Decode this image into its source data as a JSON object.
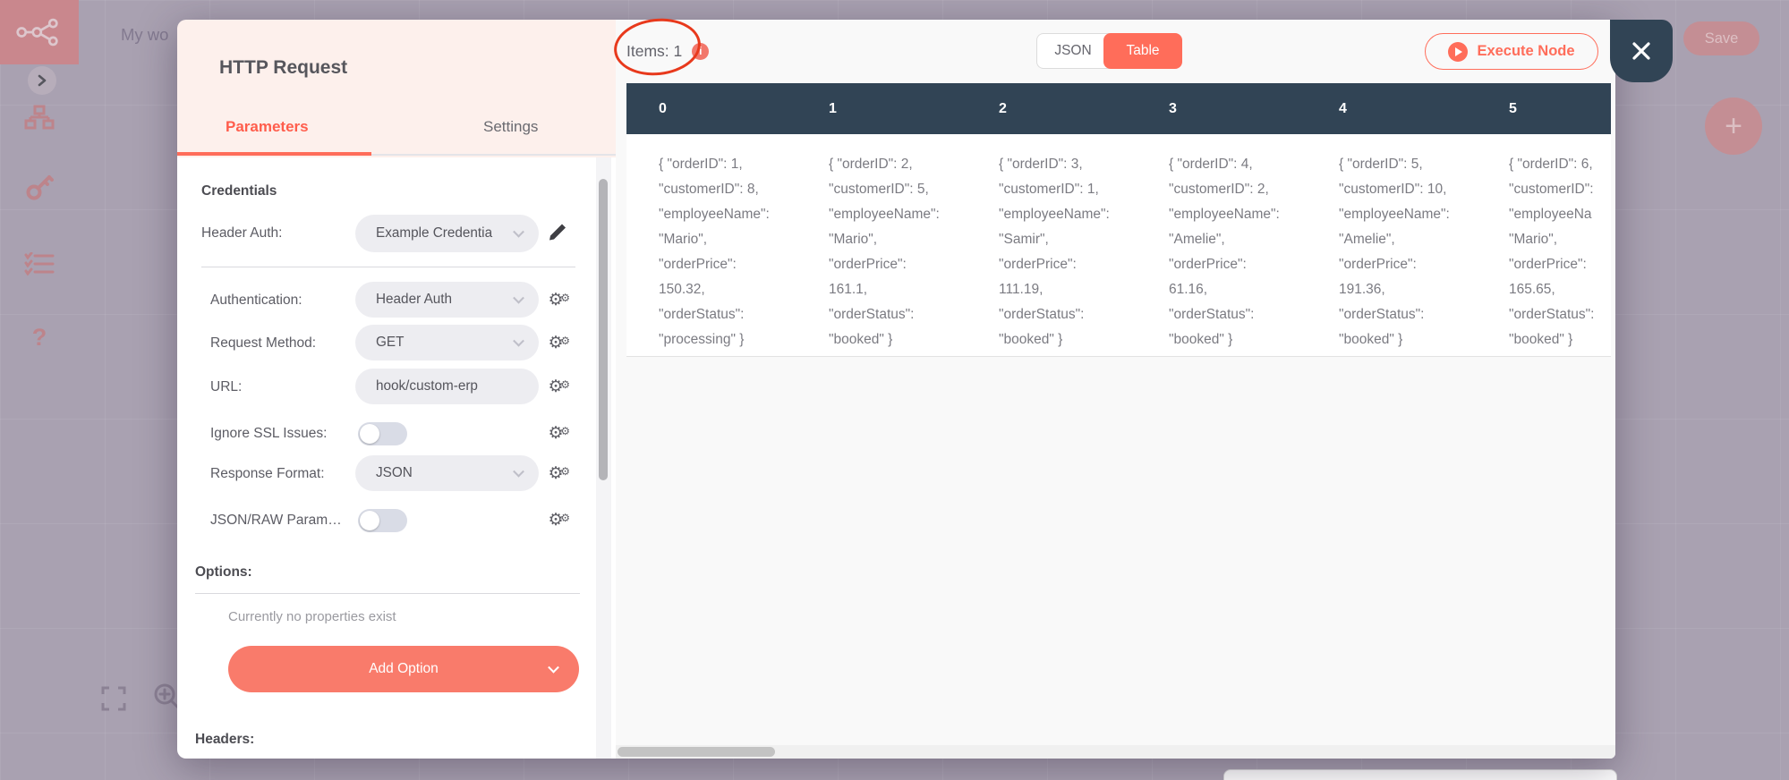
{
  "canvas": {
    "workflow_title": "My wo",
    "save_label": "Save",
    "plus_label": "+",
    "help_glyph": "?"
  },
  "modal": {
    "title": "HTTP Request",
    "tabs": {
      "parameters": "Parameters",
      "settings": "Settings",
      "active": "Parameters"
    },
    "credentials": {
      "heading": "Credentials",
      "label": "Header Auth:",
      "value": "Example Credentia"
    },
    "fields": [
      {
        "label": "Authentication:",
        "type": "select",
        "value": "Header Auth"
      },
      {
        "label": "Request Method:",
        "type": "select",
        "value": "GET"
      },
      {
        "label": "URL:",
        "type": "input",
        "value": "hook/custom-erp"
      },
      {
        "label": "Ignore SSL Issues:",
        "type": "toggle",
        "value": "off"
      },
      {
        "label": "Response Format:",
        "type": "select",
        "value": "JSON"
      },
      {
        "label": "JSON/RAW Param…",
        "type": "toggle",
        "value": "off"
      }
    ],
    "options": {
      "heading": "Options:",
      "empty_text": "Currently no properties exist",
      "add_button": "Add Option"
    },
    "headers_heading": "Headers:"
  },
  "output": {
    "items_label": "Items: 1",
    "view_toggle": {
      "json": "JSON",
      "table": "Table",
      "selected": "Table"
    },
    "execute_button": "Execute Node",
    "table": {
      "columns": [
        {
          "header": "0",
          "lines": [
            "{ \"orderID\": 1,",
            "\"customerID\": 8,",
            "\"employeeName\":",
            "\"Mario\",",
            "\"orderPrice\":",
            "150.32,",
            "\"orderStatus\":",
            "\"processing\" }"
          ]
        },
        {
          "header": "1",
          "lines": [
            "{ \"orderID\": 2,",
            "\"customerID\": 5,",
            "\"employeeName\":",
            "\"Mario\",",
            "\"orderPrice\":",
            "161.1,",
            "\"orderStatus\":",
            "\"booked\" }"
          ]
        },
        {
          "header": "2",
          "lines": [
            "{ \"orderID\": 3,",
            "\"customerID\": 1,",
            "\"employeeName\":",
            "\"Samir\",",
            "\"orderPrice\":",
            "111.19,",
            "\"orderStatus\":",
            "\"booked\" }"
          ]
        },
        {
          "header": "3",
          "lines": [
            "{ \"orderID\": 4,",
            "\"customerID\": 2,",
            "\"employeeName\":",
            "\"Amelie\",",
            "\"orderPrice\":",
            "61.16,",
            "\"orderStatus\":",
            "\"booked\" }"
          ]
        },
        {
          "header": "4",
          "lines": [
            "{ \"orderID\": 5,",
            "\"customerID\": 10,",
            "\"employeeName\":",
            "\"Amelie\",",
            "\"orderPrice\":",
            "191.36,",
            "\"orderStatus\":",
            "\"booked\" }"
          ]
        },
        {
          "header": "5",
          "lines": [
            "{ \"orderID\": 6,",
            "\"customerID\":",
            "\"employeeNa",
            "\"Mario\",",
            "\"orderPrice\":",
            "165.65,",
            "\"orderStatus\":",
            "\"booked\" }"
          ]
        }
      ]
    }
  },
  "colors": {
    "accent": "#ff6d5a",
    "table_header": "#314455",
    "annotation": "#e8391c",
    "canvas": "#a9a1b1"
  }
}
